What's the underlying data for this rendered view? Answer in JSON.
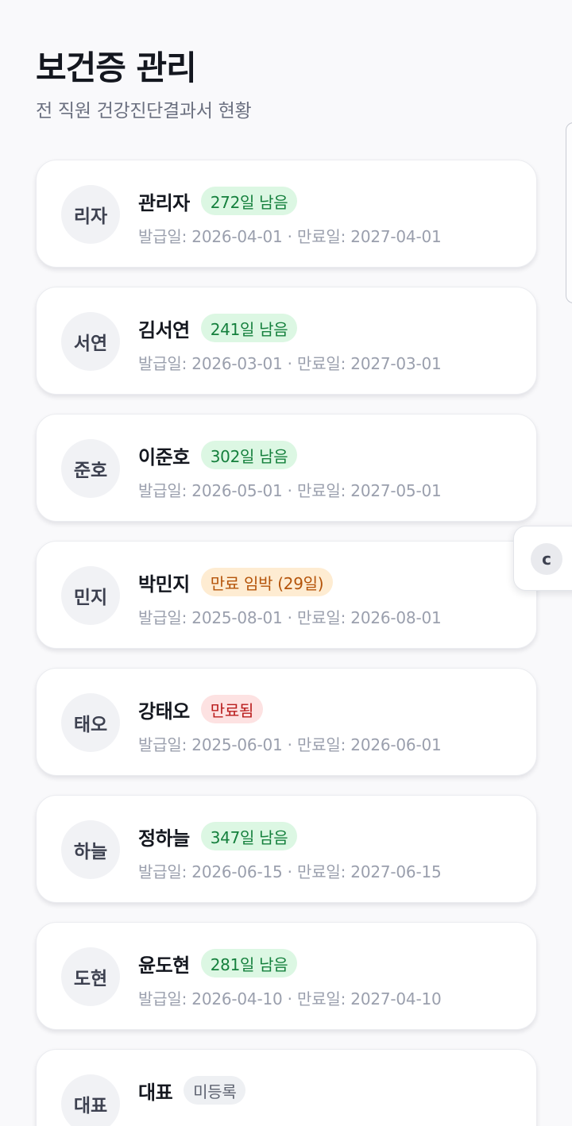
{
  "header": {
    "title": "보건증 관리",
    "subtitle": "전 직원 건강진단결과서 현황"
  },
  "employees": [
    {
      "avatar": "리자",
      "name": "관리자",
      "status": "ok",
      "badge": "272일 남음",
      "dates": "발급일: 2026-04-01 · 만료일: 2027-04-01"
    },
    {
      "avatar": "서연",
      "name": "김서연",
      "status": "ok",
      "badge": "241일 남음",
      "dates": "발급일: 2026-03-01 · 만료일: 2027-03-01"
    },
    {
      "avatar": "준호",
      "name": "이준호",
      "status": "ok",
      "badge": "302일 남음",
      "dates": "발급일: 2026-05-01 · 만료일: 2027-05-01"
    },
    {
      "avatar": "민지",
      "name": "박민지",
      "status": "warn",
      "badge": "만료 임박 (29일)",
      "dates": "발급일: 2025-08-01 · 만료일: 2026-08-01"
    },
    {
      "avatar": "태오",
      "name": "강태오",
      "status": "expired",
      "badge": "만료됨",
      "dates": "발급일: 2025-06-01 · 만료일: 2026-06-01"
    },
    {
      "avatar": "하늘",
      "name": "정하늘",
      "status": "ok",
      "badge": "347일 남음",
      "dates": "발급일: 2026-06-15 · 만료일: 2027-06-15"
    },
    {
      "avatar": "도현",
      "name": "윤도현",
      "status": "ok",
      "badge": "281일 남음",
      "dates": "발급일: 2026-04-10 · 만료일: 2027-04-10"
    },
    {
      "avatar": "대표",
      "name": "대표",
      "status": "none",
      "badge": "미등록",
      "dates": ""
    }
  ],
  "floating_widget": {
    "label": "c"
  },
  "colors": {
    "ok_bg": "#dcf7e3",
    "ok_text": "#15803d",
    "warn_bg": "#feecd2",
    "warn_text": "#b45309",
    "expired_bg": "#fde2e2",
    "expired_text": "#b91c1c",
    "none_bg": "#eef0f3",
    "none_text": "#5d6270"
  }
}
